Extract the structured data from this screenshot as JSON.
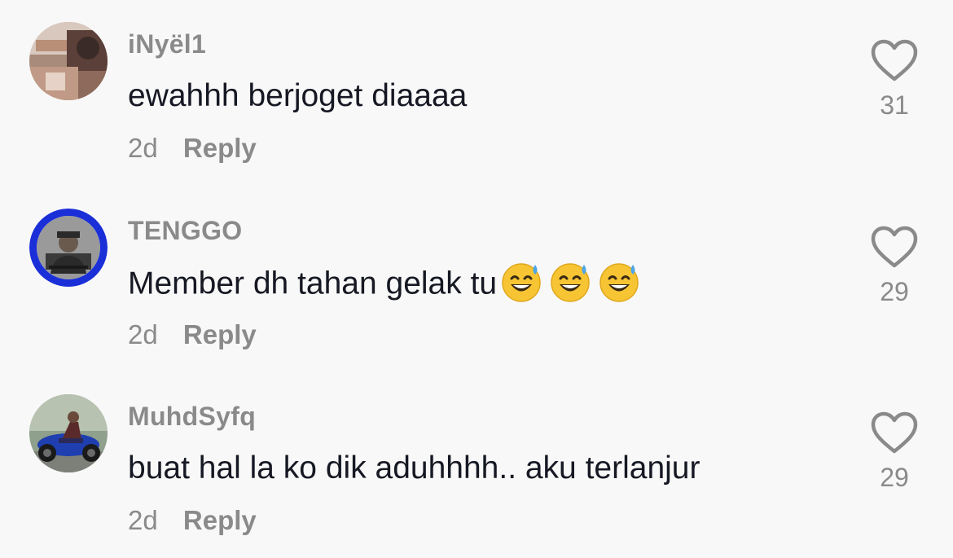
{
  "comments": [
    {
      "username": "iNyël1",
      "text": "ewahhh berjoget diaaaa",
      "time": "2d",
      "reply_label": "Reply",
      "likes": "31",
      "avatar_icon": "user-photo-avatar"
    },
    {
      "username": "TENGGO",
      "text": "Member dh tahan gelak tu",
      "emojis": [
        "😅",
        "😅",
        "😅"
      ],
      "time": "2d",
      "reply_label": "Reply",
      "likes": "29",
      "avatar_icon": "user-photo-avatar"
    },
    {
      "username": "MuhdSyfq",
      "text": "buat hal la ko dik aduhhhh.. aku terlanjur",
      "time": "2d",
      "reply_label": "Reply",
      "likes": "29",
      "avatar_icon": "user-photo-avatar"
    }
  ],
  "colors": {
    "background": "#f8f8f8",
    "text": "#161823",
    "muted": "#8a8a8a"
  }
}
